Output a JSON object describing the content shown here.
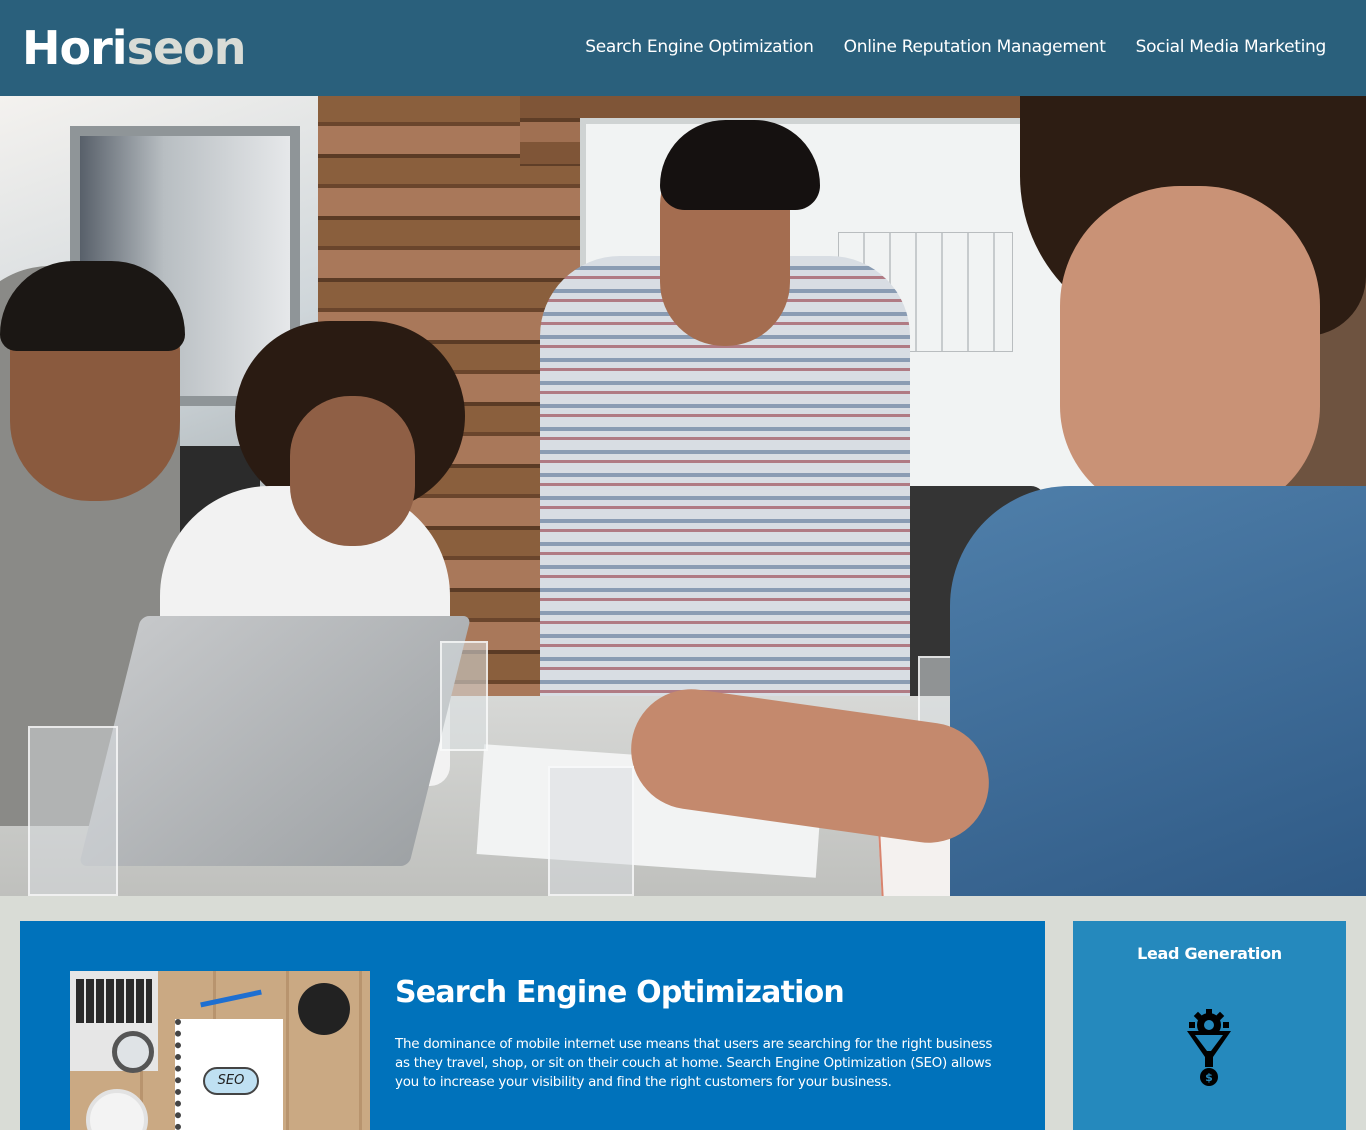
{
  "header": {
    "logo_main": "Hori",
    "logo_accent": "seon",
    "nav": [
      {
        "label": "Search Engine Optimization"
      },
      {
        "label": "Online Reputation Management"
      },
      {
        "label": "Social Media Marketing"
      }
    ]
  },
  "hero": {
    "image": "team-meeting-photo"
  },
  "main": {
    "section": {
      "image": "seo-notebook-photo",
      "image_text": "SEO",
      "title": "Search Engine Optimization",
      "body": "The dominance of mobile internet use means that users are searching for the right business as they travel, shop, or sit on their couch at home. Search Engine Optimization (SEO) allows you to increase your visibility and find the right customers for your business."
    }
  },
  "sidebar": {
    "items": [
      {
        "title": "Lead Generation",
        "icon": "lead-generation-funnel-icon"
      }
    ]
  },
  "colors": {
    "header_bg": "#2a607c",
    "page_bg": "#d9dcd6",
    "content_bg": "#0072bb",
    "sidebar_bg": "#2589bd",
    "logo_accent": "#d9dcd6"
  }
}
